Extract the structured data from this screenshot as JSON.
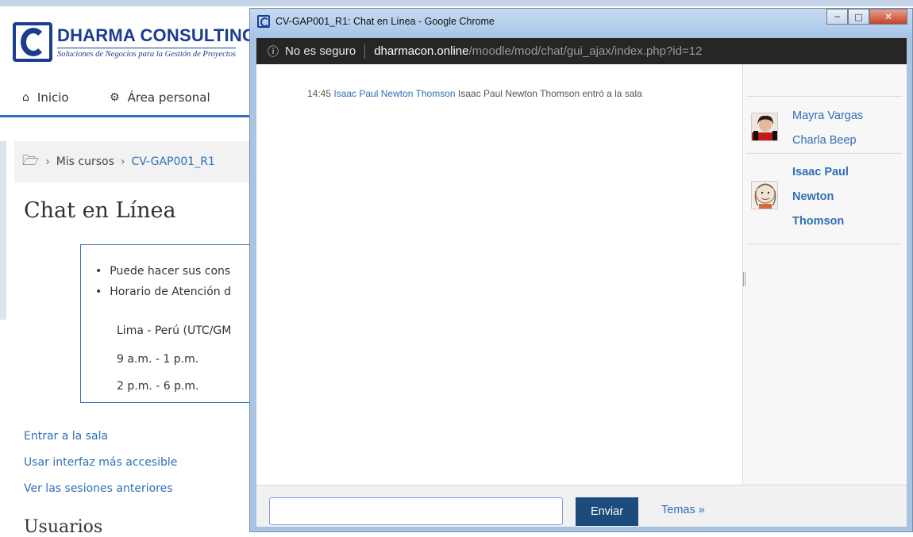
{
  "background_page": {
    "logo": {
      "title": "DHARMA CONSULTING",
      "subtitle": "Soluciones de Negocios para la Gestión de Proyectos"
    },
    "nav": [
      {
        "icon": "home-icon",
        "label": "Inicio"
      },
      {
        "icon": "dashboard-icon",
        "label": "Área personal"
      }
    ],
    "breadcrumb": {
      "items": [
        "Mis cursos",
        "CV-GAP001_R1"
      ]
    },
    "page_title": "Chat en Línea",
    "info_box": {
      "bullets": [
        "Puede hacer sus cons",
        "Horario de Atención d"
      ],
      "lines": [
        "Lima - Perú (UTC/GM",
        "9 a.m. - 1 p.m.",
        "2 p.m. - 6 p.m."
      ]
    },
    "links": [
      "Entrar a la sala",
      "Usar interfaz más accesible",
      "Ver las sesiones anteriores"
    ],
    "section_heading": "Usuarios"
  },
  "popup": {
    "window_title": "CV-GAP001_R1: Chat en Línea - Google Chrome",
    "address_bar": {
      "info_icon": "info-icon",
      "security_label": "No es seguro",
      "host": "dharmacon.online",
      "path": "/moodle/mod/chat/gui_ajax/index.php?id=12"
    },
    "messages": [
      {
        "time": "14:45",
        "user": "Isaac Paul Newton Thomson",
        "text": "Isaac Paul Newton Thomson entró a la sala"
      }
    ],
    "users": [
      {
        "name_line1": "Mayra Vargas",
        "name_line2": "Charla Beep",
        "bold": false
      },
      {
        "name_line1": "Isaac Paul",
        "name_line2": "Newton",
        "name_line3": "Thomson",
        "bold": true
      }
    ],
    "input": {
      "value": "",
      "placeholder": ""
    },
    "send_label": "Enviar",
    "themes_label": "Temas »"
  },
  "colors": {
    "brand": "#1a3d8f",
    "link": "#2f6fb6",
    "send_button": "#1b4c7c",
    "address_bar": "#262626"
  }
}
